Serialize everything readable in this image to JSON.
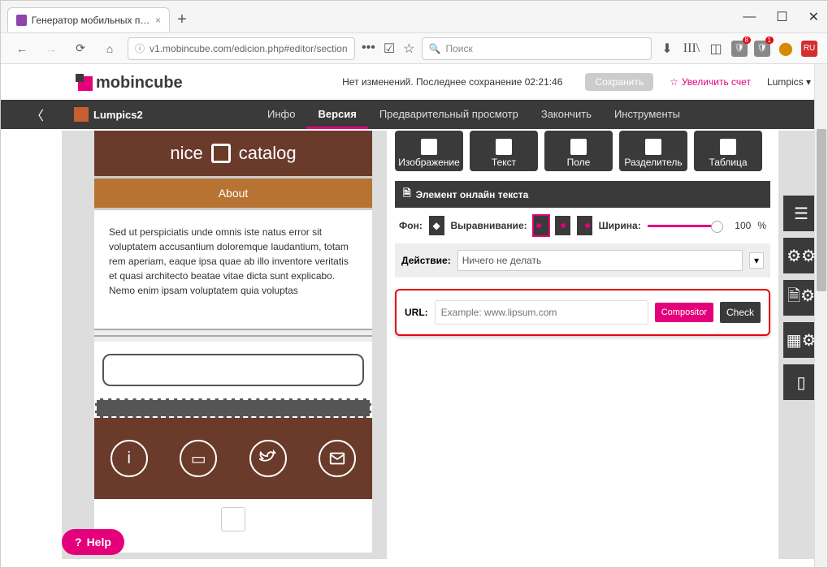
{
  "browser": {
    "tab_title": "Генератор мобильных прило",
    "url": "v1.mobincube.com/edicion.php#editor/section",
    "search_placeholder": "Поиск",
    "ext_badges": {
      "red1": "8",
      "red2": "1",
      "lang": "RU"
    },
    "win": {
      "min": "—",
      "max": "☐",
      "close": "✕"
    }
  },
  "header": {
    "logo_text": "mobincube",
    "status_text": "Нет изменений. Последнее сохранение 02:21:46",
    "save": "Сохранить",
    "upgrade": "Увеличить счет",
    "user": "Lumpics"
  },
  "subnav": {
    "project": "Lumpics2",
    "items": [
      "Инфо",
      "Версия",
      "Предварительный просмотр",
      "Закончить",
      "Инструменты"
    ]
  },
  "phone": {
    "title_left": "nice",
    "title_right": "catalog",
    "about": "About",
    "text": "Sed ut perspiciatis unde omnis iste natus error sit voluptatem accusantium doloremque laudantium, totam rem aperiam, eaque ipsa quae ab illo inventore veritatis et quasi architecto beatae vitae dicta sunt explicabo. Nemo enim ipsam voluptatem quia voluptas",
    "footer_icons": [
      "info",
      "book",
      "twitter",
      "mail"
    ]
  },
  "tools": [
    "Изображение",
    "Текст",
    "Поле",
    "Разделитель",
    "Таблица"
  ],
  "panel": {
    "heading": "Элемент онлайн текста",
    "bg_label": "Фон:",
    "align_label": "Выравнивание:",
    "width_label": "Ширина:",
    "width_value": "100",
    "pct": "%",
    "action_label": "Действие:",
    "action_value": "Ничего не делать",
    "url_label": "URL:",
    "url_placeholder": "Example: www.lipsum.com",
    "compositor": "Compositor",
    "check": "Check"
  },
  "help": "Help"
}
